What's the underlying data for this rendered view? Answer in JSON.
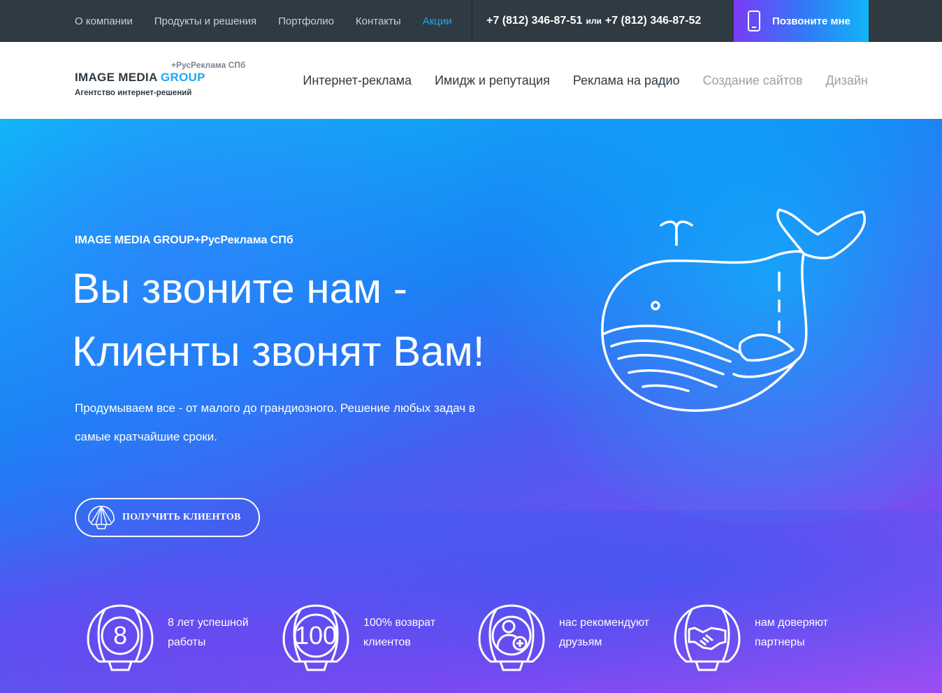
{
  "topbar": {
    "nav": [
      {
        "label": "О компании",
        "active": false
      },
      {
        "label": "Продукты и решения",
        "active": false
      },
      {
        "label": "Портфолио",
        "active": false
      },
      {
        "label": "Контакты",
        "active": false
      },
      {
        "label": "Акции",
        "active": true
      }
    ],
    "phone1": "+7 (812) 346-87-51",
    "or": "или",
    "phone2": "+7 (812) 346-87-52",
    "call_button": "Позвоните мне",
    "call_icon": "smartphone-icon",
    "bg_color": "#2f3a42",
    "accent_color": "#1ea8f0"
  },
  "header": {
    "logo": {
      "sub": "+РусРеклама СПб",
      "main_a": "IMAGE MEDIA ",
      "main_b": "GROUP",
      "tagline": "Агентство интернет-решений"
    },
    "nav": [
      {
        "label": "Интернет-реклама",
        "muted": false
      },
      {
        "label": "Имидж и репутация",
        "muted": false
      },
      {
        "label": "Реклама на радио",
        "muted": false
      },
      {
        "label": "Создание сайтов",
        "muted": true
      },
      {
        "label": "Дизайн",
        "muted": true
      }
    ]
  },
  "hero": {
    "kicker": "IMAGE MEDIA GROUP+РусРеклама СПб",
    "headline_line1": "Вы звоните нам -",
    "headline_line2": "Клиенты звонят Вам!",
    "description": "Продумываем все - от малого до грандиозного. Решение любых задач в самые кратчайшие сроки.",
    "cta_label": "ПОЛУЧИТЬ КЛИЕНТОВ",
    "cta_icon": "shell-icon",
    "illustration": "whale-icon"
  },
  "stats": [
    {
      "badge": "8",
      "icon": "shell-number-icon",
      "line1": "8 лет успешной",
      "line2": "работы"
    },
    {
      "badge": "100",
      "icon": "shell-number-icon",
      "line1": "100% возврат",
      "line2": "клиентов"
    },
    {
      "badge": "",
      "icon": "shell-user-add-icon",
      "line1": "нас рекомендуют",
      "line2": "друзьям"
    },
    {
      "badge": "",
      "icon": "shell-handshake-icon",
      "line1": "нам доверяют",
      "line2": "партнеры"
    }
  ]
}
